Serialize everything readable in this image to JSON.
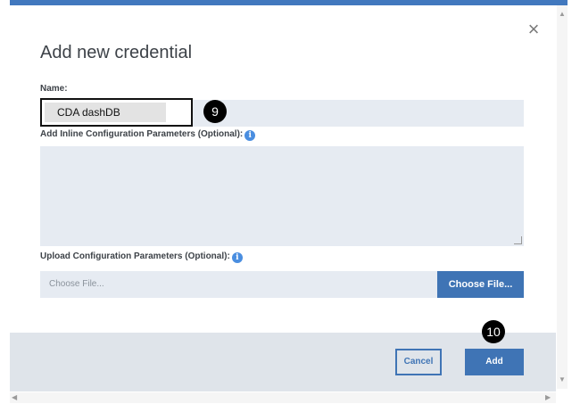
{
  "modal": {
    "title": "Add new credential",
    "close_glyph": "×"
  },
  "form": {
    "name_label": "Name:",
    "name_value": "CDA dashDB",
    "inline_label": "Add Inline Configuration Parameters (Optional):",
    "upload_label": "Upload Configuration Parameters (Optional):",
    "file_placeholder": "Choose File...",
    "choose_file_button": "Choose File..."
  },
  "footer": {
    "cancel_label": "Cancel",
    "add_label": "Add"
  },
  "annotations": {
    "step_9": "9",
    "step_10": "10"
  },
  "icons": {
    "info": "info-icon",
    "close": "close-icon"
  },
  "colors": {
    "accent": "#3f74b5",
    "top_bar": "#4178be",
    "field_bg": "#e6ebf2",
    "footer_bg": "#dfe4ea"
  }
}
